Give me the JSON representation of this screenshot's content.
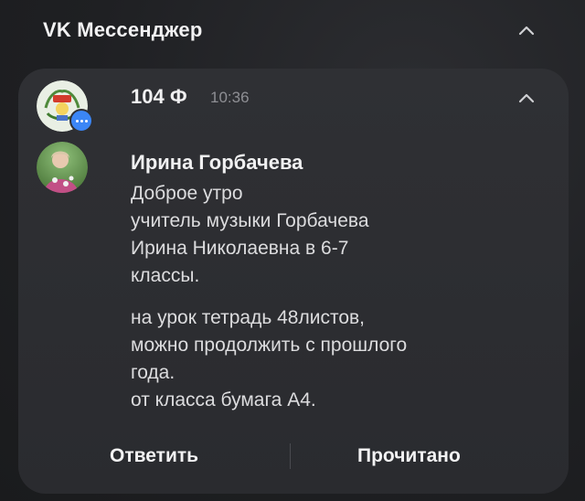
{
  "app": {
    "title": "VK Мессенджер"
  },
  "notification": {
    "chat_name": "104 Ф",
    "time": "10:36",
    "sender": "Ирина Горбачева",
    "message_part1": "Доброе утро\nучитель музыки Горбачева\nИрина Николаевна в 6-7\nклассы.",
    "message_part2": "на урок тетрадь 48листов,\nможно продолжить с прошлого\nгода.\nот класса бумага А4."
  },
  "actions": {
    "reply_label": "Ответить",
    "read_label": "Прочитано"
  },
  "colors": {
    "accent_badge": "#3b86f6",
    "card_bg": "#2f3034",
    "background": "#1f2023"
  },
  "icons": {
    "collapse": "chevron-up-icon",
    "badge": "chat-bubble-icon"
  }
}
